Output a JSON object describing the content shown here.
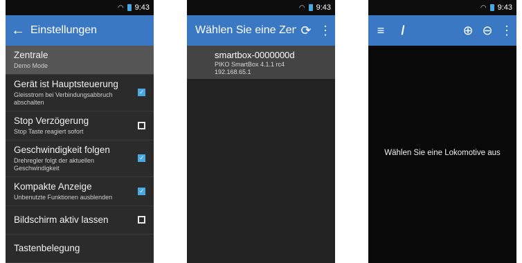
{
  "status": {
    "time": "9:43"
  },
  "screen1": {
    "title": "Einstellungen",
    "settings": [
      {
        "title": "Zentrale",
        "subtitle": "Demo Mode",
        "checkbox": null,
        "selected": true
      },
      {
        "title": "Gerät ist Hauptsteuerung",
        "subtitle": "Gleisstrom bei Verbindungsabbruch abschalten",
        "checkbox": true
      },
      {
        "title": "Stop Verzögerung",
        "subtitle": "Stop Taste reagiert sofort",
        "checkbox": false
      },
      {
        "title": "Geschwindigkeit folgen",
        "subtitle": "Drehregler folgt der aktuellen Geschwindigkeit",
        "checkbox": true
      },
      {
        "title": "Kompakte Anzeige",
        "subtitle": "Unbenutzte Funktionen ausblenden",
        "checkbox": true
      },
      {
        "title": "Bildschirm aktiv lassen",
        "subtitle": "",
        "checkbox": false
      },
      {
        "title": "Tastenbelegung",
        "subtitle": "",
        "checkbox": null
      }
    ]
  },
  "screen2": {
    "title": "Wählen Sie eine Zentr…",
    "device": {
      "name": "smartbox-0000000d",
      "version": "PIKO SmartBox 4.1.1 rc4",
      "ip": "192.168.65.1"
    }
  },
  "screen3": {
    "message": "Wählen Sie eine Lokomotive aus"
  },
  "icons": {
    "back": "arrow-left-icon",
    "refresh": "refresh-icon",
    "overflow": "overflow-menu-icon",
    "menu": "hamburger-menu-icon",
    "controller": "controller-icon",
    "add": "add-circle-icon",
    "remove": "remove-circle-icon"
  },
  "colors": {
    "appbar": "#3a78c3",
    "accent": "#49a7e2"
  }
}
